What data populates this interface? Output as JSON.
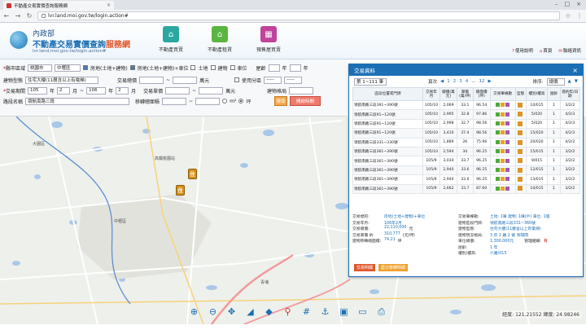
{
  "browser": {
    "tab_title": "不動產交易實價查詢服務網",
    "url": "lvr.land.moi.gov.tw/login.action#"
  },
  "header": {
    "logo_sub": "內政部",
    "logo_main": "不動產交易實價查詢",
    "logo_accent": "服務網",
    "nav": [
      {
        "label": "不動產買賣",
        "color": "#2aa8a0",
        "icon": "house-buy-icon"
      },
      {
        "label": "不動產租賃",
        "color": "#5bb541",
        "icon": "house-rent-icon"
      },
      {
        "label": "預售屋買賣",
        "color": "#c0439c",
        "icon": "presale-icon"
      }
    ],
    "links": [
      "使用說明",
      "首頁",
      "聯絡資訊"
    ]
  },
  "search": {
    "county_label": "縣市區域",
    "county": "桃園市",
    "district": "中壢區",
    "type_opts": [
      "房地(土地+建物)",
      "房地(土地+建物)+車位",
      "土地",
      "建物",
      "車位"
    ],
    "land_label": "屋齡",
    "land_unit": "年",
    "build_type_label": "建物型態",
    "build_type": "住宅大樓(11層含以上有電梯)",
    "total_price_label": "交易總價",
    "price_unit": "萬元",
    "use_label": "使用分區",
    "use_val": "-----",
    "date_label": "交易期間",
    "date_from_y": "105",
    "date_from_m": "2",
    "date_to_y": "106",
    "date_to_m": "2",
    "year_unit": "年",
    "month_unit": "月",
    "unit_price_label": "交易單價",
    "unit_price_unit": "萬元",
    "build_name_label": "建物格局",
    "road_label": "路段名稱",
    "road": "領航南路三段",
    "area_label": "移轉總面積",
    "area_unit_m2": "m²",
    "area_unit_ping": "坪",
    "search_btn": "搜尋",
    "open_btn": "開啟時間"
  },
  "panel": {
    "title": "交易資料",
    "page_select": "第 1~111 筆",
    "pages_label": "頁次",
    "pages": [
      "1",
      "2",
      "3",
      "4",
      "...",
      "12"
    ],
    "sort_label": "排序:",
    "sort_val": "總價",
    "headers": [
      "區段位置或門牌",
      "交易年月",
      "總價(萬元)",
      "單價(萬/坪)",
      "總面積(坪)",
      "交易筆棟數",
      "型態",
      "樓別/樓高",
      "屋齡",
      "簽約年/日期"
    ],
    "rows": [
      {
        "addr": "領航南路三段391~390號",
        "ym": "105/10",
        "total": "2,069",
        "unit": "33.1",
        "area": "96.54",
        "count": "1 1 0",
        "floor": "10/015",
        "age": "1",
        "date": "3/2/2"
      },
      {
        "addr": "領航南路三段91~120號",
        "ym": "105/10",
        "total": "2,995",
        "unit": "32.8",
        "area": "97.86",
        "count": "1 1 0",
        "floor": "5/020",
        "age": "1",
        "date": "4/2/3"
      },
      {
        "addr": "領航南路三段91~120號",
        "ym": "105/10",
        "total": "2,998",
        "unit": "32.7",
        "area": "98.56",
        "count": "1 1 0",
        "floor": "5/020",
        "age": "1",
        "date": "4/2/3"
      },
      {
        "addr": "領航南路三段91~120號",
        "ym": "105/10",
        "total": "3,410",
        "unit": "37.4",
        "area": "98.56",
        "count": "1 1 0",
        "floor": "15/020",
        "age": "1",
        "date": "4/2/3"
      },
      {
        "addr": "領航南路三段331~330號",
        "ym": "105/10",
        "total": "1,889",
        "unit": "26",
        "area": "75.96",
        "count": "1 1 0",
        "floor": "20/020",
        "age": "1",
        "date": "4/2/2"
      },
      {
        "addr": "領航南路三段361~390號",
        "ym": "105/10",
        "total": "2,594",
        "unit": "34",
        "area": "96.25",
        "count": "1 1 0",
        "floor": "15/015",
        "age": "1",
        "date": "3/2/2"
      },
      {
        "addr": "領航南路三段361~390號",
        "ym": "105/9",
        "total": "3,034",
        "unit": "33.7",
        "area": "96.25",
        "count": "1 1 0",
        "floor": "9/015",
        "age": "1",
        "date": "3/2/2"
      },
      {
        "addr": "領航南路三段361~390號",
        "ym": "105/9",
        "total": "2,940",
        "unit": "33.6",
        "area": "96.25",
        "count": "1 1 0",
        "floor": "12/015",
        "age": "1",
        "date": "3/2/2"
      },
      {
        "addr": "領航南路三段361~390號",
        "ym": "105/9",
        "total": "2,940",
        "unit": "33.6",
        "area": "96.25",
        "count": "1 1 0",
        "floor": "13/015",
        "age": "1",
        "date": "3/2/2"
      },
      {
        "addr": "領航南路三段361~390號",
        "ym": "105/9",
        "total": "2,662",
        "unit": "33.7",
        "area": "87.60",
        "count": "1 1 0",
        "floor": "10/015",
        "age": "1",
        "date": "3/2/2"
      }
    ],
    "detail_left": [
      {
        "k": "交易標的:",
        "v": "房地(土地+建物)+車位"
      },
      {
        "k": "交易年月:",
        "v": "106年2月"
      },
      {
        "k": "交易總價:",
        "v": "22,110,000",
        "u": "元"
      },
      {
        "k": "交易單價 約",
        "v": "310,777",
        "u": "(元/坪)"
      },
      {
        "k": "建物移轉總面積:",
        "v": "74.21",
        "u": "坪"
      }
    ],
    "detail_right": [
      {
        "k": "交易筆棟數:",
        "v": "土地: 1筆 建物: 1棟(戶) 車位: 1個"
      },
      {
        "k": "建物區段門牌:",
        "v": "領航南路三段331~360號"
      },
      {
        "k": "建物型態:",
        "v": "住宅大樓(11層含以上有電梯)"
      },
      {
        "k": "建物現況格局:",
        "v": "3 房 2 廳 2 衛 有隔間"
      },
      {
        "k": "車位總價:",
        "v": "1,300,000元",
        "extra": "管理組織:",
        "extra_v": "有"
      },
      {
        "k": "屋齡:",
        "v": "1 年"
      },
      {
        "k": "樓別/樓高:",
        "v": "六層/015"
      }
    ],
    "btn_a": "交易明細",
    "btn_b": "歷次移轉明細"
  },
  "map": {
    "labels": [
      {
        "text": "中壢區",
        "key": "a"
      },
      {
        "text": "高鐵桃園站",
        "key": "b"
      },
      {
        "text": "青埔",
        "key": "c"
      },
      {
        "text": "大園區",
        "key": "d"
      }
    ],
    "marker_text": "住",
    "coords": "經度: 121.21552 緯度: 24.98246"
  }
}
